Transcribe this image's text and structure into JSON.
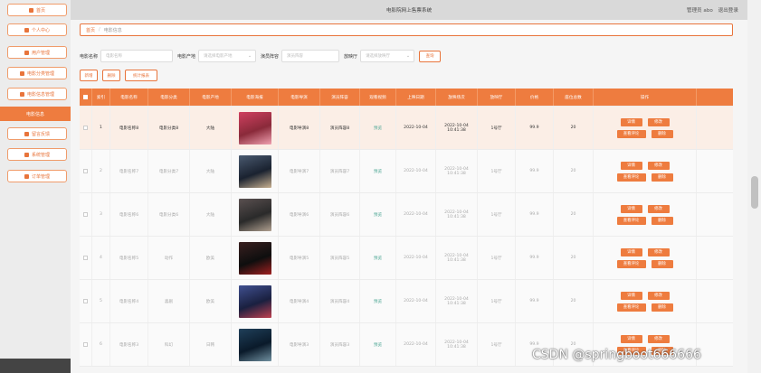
{
  "header": {
    "title": "电影院网上售票系统",
    "user": "管理员 abo",
    "logout": "退出登录"
  },
  "sidebar": {
    "items": [
      {
        "label": "首页",
        "icon": "home-icon"
      },
      {
        "label": "个人中心",
        "icon": "user-icon"
      },
      {
        "label": "用户管理",
        "icon": "flag-icon"
      },
      {
        "label": "电影分类管理",
        "icon": "grid-icon"
      },
      {
        "label": "电影信息管理",
        "icon": "grid-icon"
      },
      {
        "label": "电影信息",
        "icon": "",
        "active": true
      },
      {
        "label": "留言反馈",
        "icon": "grid-icon"
      },
      {
        "label": "系统管理",
        "icon": "grid-icon"
      },
      {
        "label": "订单管理",
        "icon": "list-icon"
      }
    ]
  },
  "breadcrumb": {
    "home": "首页",
    "sep": "/",
    "current": "电影信息"
  },
  "search": {
    "name_label": "电影名称",
    "name_placeholder": "电影名称",
    "origin_label": "电影产地",
    "origin_placeholder": "请选择电影产地",
    "cast_label": "演员阵容",
    "cast_placeholder": "演员阵容",
    "hall_label": "放映厅",
    "hall_placeholder": "请选择放映厅",
    "button": "查询"
  },
  "actions": {
    "add": "新增",
    "delete": "删除",
    "report": "统计报表"
  },
  "table": {
    "columns": [
      "",
      "索引",
      "电影名称",
      "电影分类",
      "电影产地",
      "电影海报",
      "电影导演",
      "演员阵容",
      "观看视频",
      "上映日期",
      "放映场次",
      "放映厅",
      "价格",
      "座位总数",
      "操作"
    ],
    "rows": [
      {
        "index": "1",
        "name": "电影名称8",
        "category": "电影分类8",
        "origin": "大陆",
        "director": "电影导演8",
        "cast": "演员阵容8",
        "video": "预览",
        "date": "2022-10-04",
        "time": "2022-10-04 10:41:38",
        "hall": "1号厅",
        "price": "99.9",
        "seats": "20",
        "poster": [
          "#8a2a3a",
          "#d04060",
          "#f0a0b0"
        ]
      },
      {
        "index": "2",
        "name": "电影名称7",
        "category": "电影分类7",
        "origin": "大陆",
        "director": "电影导演7",
        "cast": "演员阵容7",
        "video": "预览",
        "date": "2022-10-04",
        "time": "2022-10-04 10:41:38",
        "hall": "1号厅",
        "price": "99.9",
        "seats": "20",
        "poster": [
          "#1a2230",
          "#4a5a70",
          "#c8b090"
        ]
      },
      {
        "index": "3",
        "name": "电影名称6",
        "category": "电影分类6",
        "origin": "大陆",
        "director": "电影导演6",
        "cast": "演员阵容6",
        "video": "预览",
        "date": "2022-10-04",
        "time": "2022-10-04 10:41:38",
        "hall": "1号厅",
        "price": "99.9",
        "seats": "20",
        "poster": [
          "#2a2a2a",
          "#5a5050",
          "#b0a090"
        ]
      },
      {
        "index": "4",
        "name": "电影名称5",
        "category": "动作",
        "origin": "欧美",
        "director": "电影导演5",
        "cast": "演员阵容5",
        "video": "预览",
        "date": "2022-10-04",
        "time": "2022-10-04 10:41:38",
        "hall": "1号厅",
        "price": "99.9",
        "seats": "20",
        "poster": [
          "#0e0e0e",
          "#3a2020",
          "#a02020"
        ]
      },
      {
        "index": "5",
        "name": "电影名称4",
        "category": "喜剧",
        "origin": "欧美",
        "director": "电影导演4",
        "cast": "演员阵容4",
        "video": "预览",
        "date": "2022-10-04",
        "time": "2022-10-04 10:41:38",
        "hall": "1号厅",
        "price": "99.9",
        "seats": "20",
        "poster": [
          "#1a2040",
          "#405090",
          "#c04050"
        ]
      },
      {
        "index": "6",
        "name": "电影名称3",
        "category": "科幻",
        "origin": "日韩",
        "director": "电影导演3",
        "cast": "演员阵容3",
        "video": "预览",
        "date": "2022-10-04",
        "time": "2022-10-04 10:41:38",
        "hall": "1号厅",
        "price": "99.9",
        "seats": "20",
        "poster": [
          "#0a1a2a",
          "#20405a",
          "#7090a0"
        ]
      }
    ],
    "ops": {
      "detail": "详情",
      "edit": "修改",
      "comment": "查看评论",
      "delete": "删除"
    }
  },
  "watermark": "CSDN @springboot666666"
}
